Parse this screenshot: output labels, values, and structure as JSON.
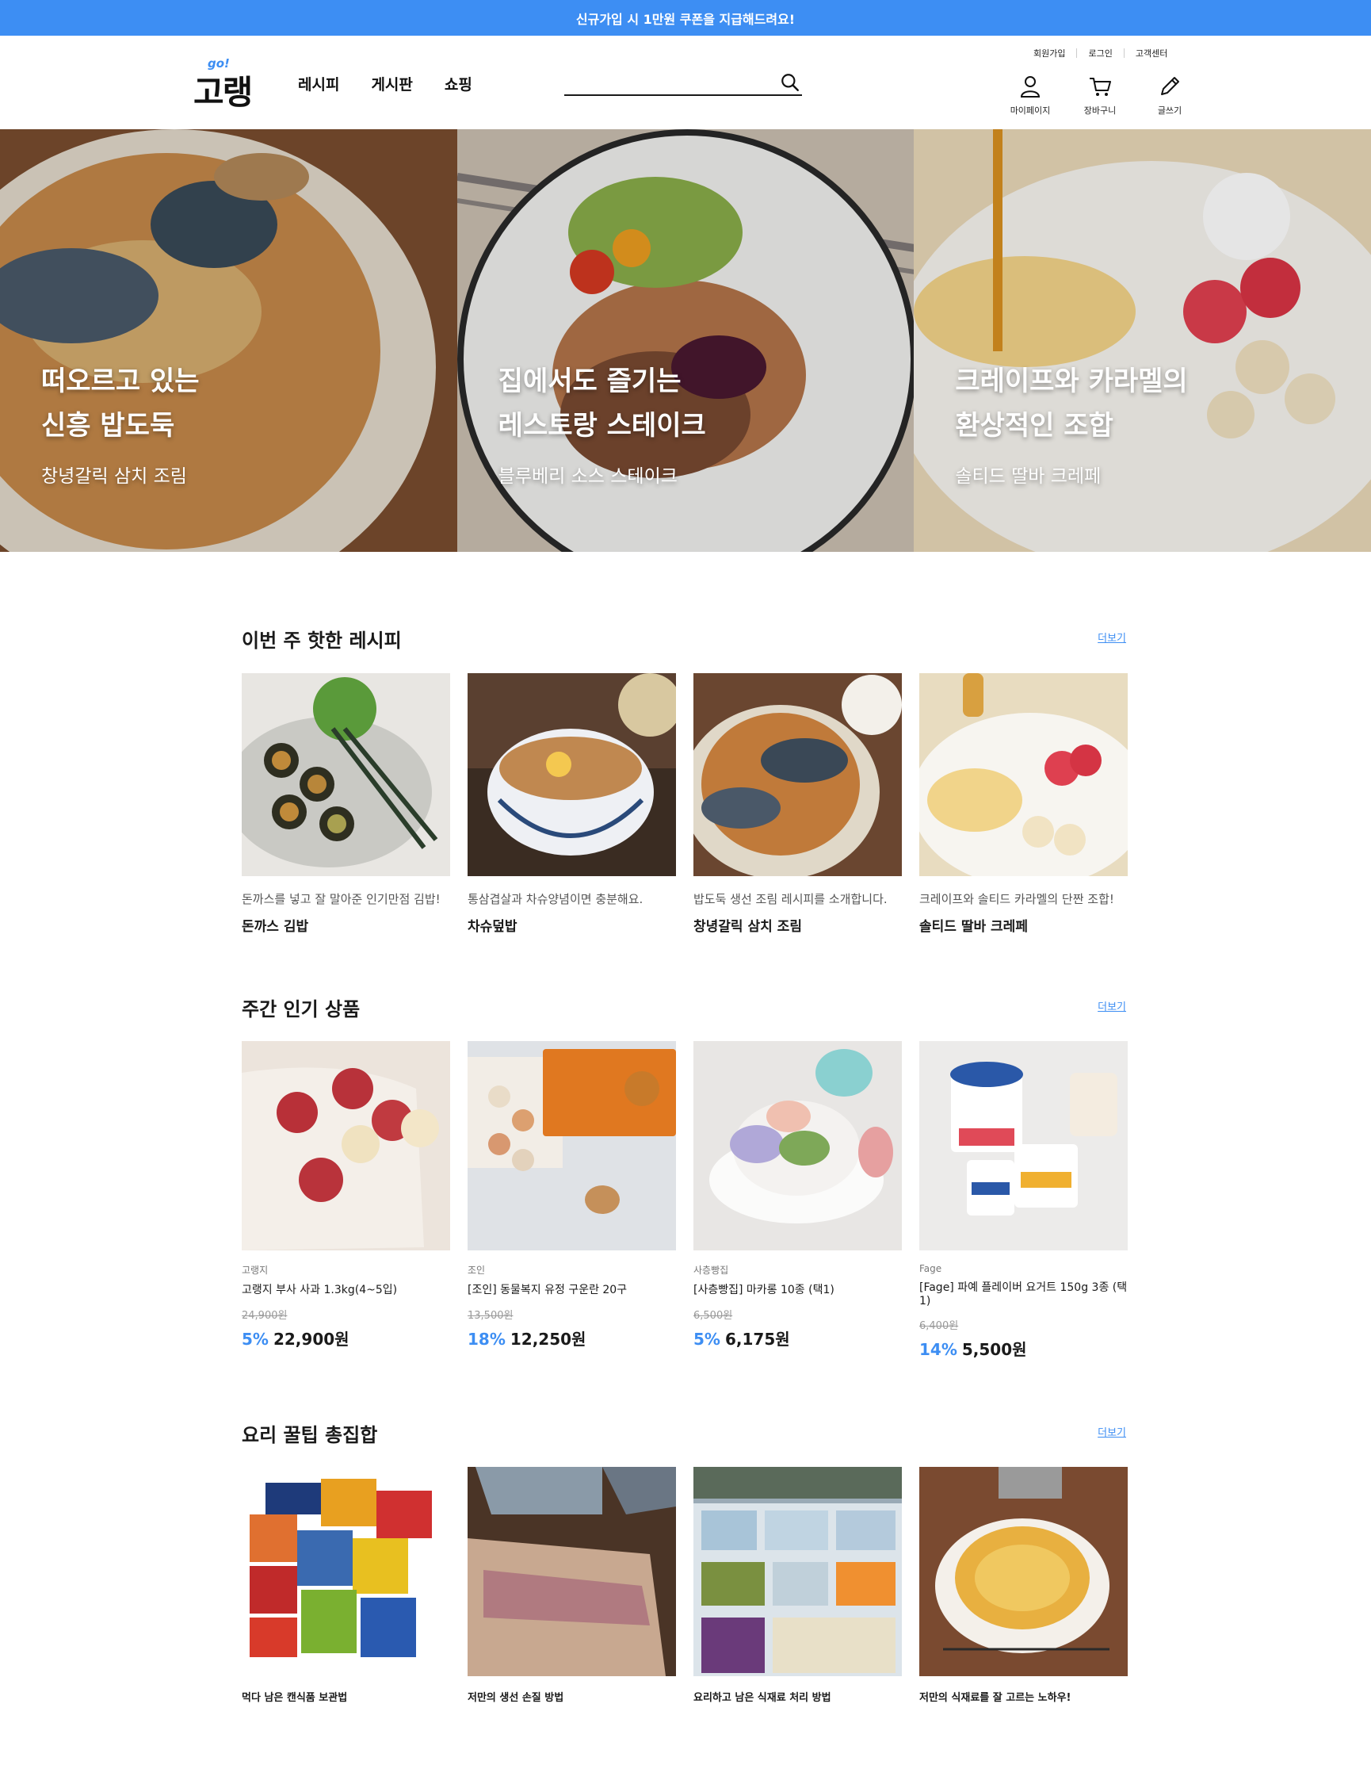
{
  "banner": {
    "text": "신규가입 시 1만원 쿠폰을 지급해드려요!"
  },
  "header": {
    "logo_go": "go!",
    "logo_name": "고랭",
    "nav": [
      "레시피",
      "게시판",
      "쇼핑"
    ],
    "search_placeholder": "",
    "utility": [
      "회원가입",
      "로그인",
      "고객센터"
    ],
    "quick": [
      "마이페이지",
      "장바구니",
      "글쓰기"
    ]
  },
  "hero": [
    {
      "title_line1": "떠오르고 있는",
      "title_line2": "신흥 밥도둑",
      "subtitle": "창녕갈릭 삼치 조림"
    },
    {
      "title_line1": "집에서도 즐기는",
      "title_line2": "레스토랑 스테이크",
      "subtitle": "블루베리 소스 스테이크"
    },
    {
      "title_line1": "크레이프와 카라멜의",
      "title_line2": "환상적인 조합",
      "subtitle": "솔티드 딸바 크레페"
    }
  ],
  "recipes": {
    "heading": "이번 주 핫한 레시피",
    "more": "더보기",
    "items": [
      {
        "desc": "돈까스를 넣고 잘 말아준 인기만점 김밥!",
        "title": "돈까스 김밥"
      },
      {
        "desc": "통삼겹살과 차슈양념이면 충분해요.",
        "title": "차슈덮밥"
      },
      {
        "desc": "밥도둑 생선 조림 레시피를 소개합니다.",
        "title": "창녕갈릭 삼치 조림"
      },
      {
        "desc": "크레이프와 솔티드 카라멜의 단짠 조합!",
        "title": "솔티드 딸바 크레페"
      }
    ]
  },
  "products": {
    "heading": "주간 인기 상품",
    "more": "더보기",
    "items": [
      {
        "brand": "고랭지",
        "name": "고랭지 부사 사과 1.3kg(4~5입)",
        "original_price": "24,900원",
        "discount": "5%",
        "price": "22,900원"
      },
      {
        "brand": "조인",
        "name": "[조인] 동물복지 유정 구운란 20구",
        "original_price": "13,500원",
        "discount": "18%",
        "price": "12,250원"
      },
      {
        "brand": "사층빵집",
        "name": "[사층빵집] 마카롱 10종 (택1)",
        "original_price": "6,500원",
        "discount": "5%",
        "price": "6,175원"
      },
      {
        "brand": "Fage",
        "name": "[Fage] 파예 플레이버 요거트 150g 3종 (택1)",
        "original_price": "6,400원",
        "discount": "14%",
        "price": "5,500원"
      }
    ]
  },
  "tips": {
    "heading": "요리 꿀팁 총집합",
    "more": "더보기",
    "items": [
      {
        "title": "먹다 남은 캔식품 보관법"
      },
      {
        "title": "저만의 생선 손질 방법"
      },
      {
        "title": "요리하고 남은 식재료 처리 방법"
      },
      {
        "title": "저만의 식재료를 잘 고르는 노하우!"
      }
    ]
  },
  "colors": {
    "accent": "#3d8ef3",
    "text": "#1a1a1a",
    "muted": "#999999"
  },
  "icons": [
    "search-icon",
    "user-icon",
    "cart-icon",
    "pencil-icon"
  ]
}
